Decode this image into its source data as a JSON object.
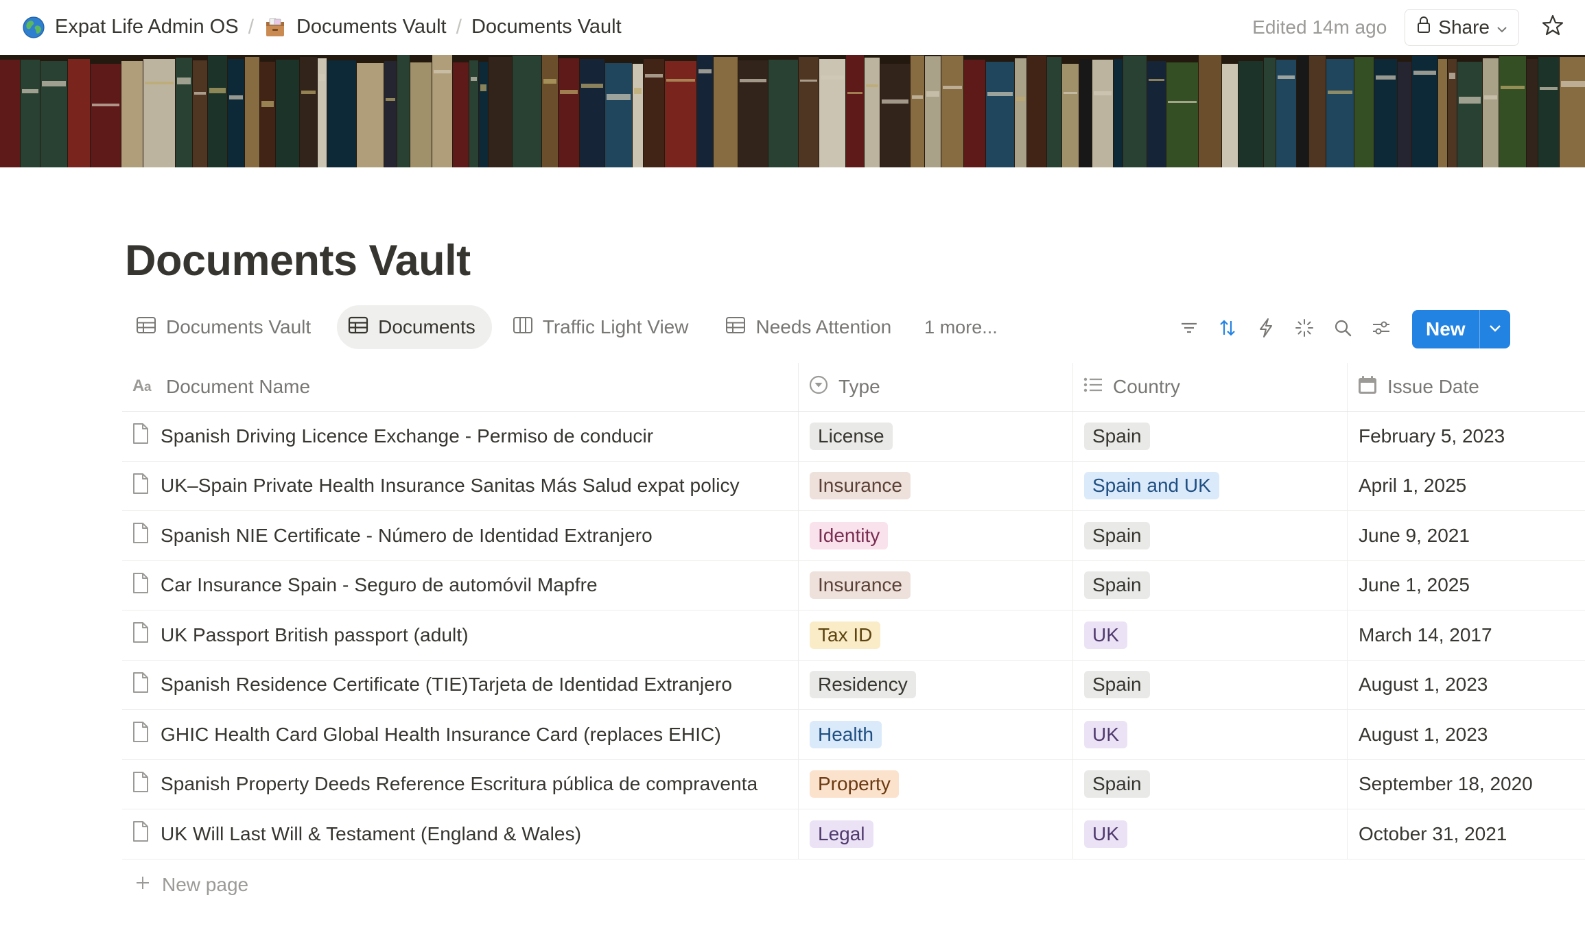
{
  "breadcrumbs": [
    {
      "label": "Expat Life Admin OS",
      "icon": "globe-icon"
    },
    {
      "label": "Documents Vault",
      "icon": "file-box-icon"
    },
    {
      "label": "Documents Vault",
      "icon": ""
    }
  ],
  "header": {
    "edited": "Edited 14m ago",
    "share_label": "Share"
  },
  "page": {
    "title": "Documents Vault"
  },
  "views": {
    "tabs": [
      {
        "label": "Documents Vault",
        "icon": "table-icon",
        "active": false
      },
      {
        "label": "Documents",
        "icon": "table-icon",
        "active": true
      },
      {
        "label": "Traffic Light View",
        "icon": "board-icon",
        "active": false
      },
      {
        "label": "Needs Attention",
        "icon": "table-icon",
        "active": false
      }
    ],
    "more": "1 more...",
    "new_label": "New"
  },
  "table": {
    "columns": [
      {
        "label": "Document Name",
        "icon": "text-type-icon"
      },
      {
        "label": "Type",
        "icon": "select-icon"
      },
      {
        "label": "Country",
        "icon": "multi-select-icon"
      },
      {
        "label": "Issue Date",
        "icon": "calendar-icon"
      }
    ],
    "rows": [
      {
        "name": "Spanish Driving Licence Exchange - Permiso de conducir",
        "type": "License",
        "country": "Spain",
        "date": "February 5, 2023"
      },
      {
        "name": "UK–Spain Private Health Insurance Sanitas Más Salud expat policy",
        "type": "Insurance",
        "country": "Spain and UK",
        "date": "April 1, 2025"
      },
      {
        "name": "Spanish NIE Certificate - Número de Identidad Extranjero",
        "type": "Identity",
        "country": "Spain",
        "date": "June 9, 2021"
      },
      {
        "name": "Car Insurance Spain - Seguro de automóvil Mapfre",
        "type": "Insurance",
        "country": "Spain",
        "date": "June 1, 2025"
      },
      {
        "name": "UK Passport British passport (adult)",
        "type": "Tax ID",
        "country": "UK",
        "date": "March 14, 2017"
      },
      {
        "name": "Spanish Residence Certificate (TIE)Tarjeta de Identidad Extranjero",
        "type": "Residency",
        "country": "Spain",
        "date": "August 1, 2023"
      },
      {
        "name": "GHIC Health Card Global Health Insurance Card (replaces EHIC)",
        "type": "Health",
        "country": "UK",
        "date": "August 1, 2023"
      },
      {
        "name": "Spanish Property Deeds Reference Escritura pública de compraventa",
        "type": "Property",
        "country": "Spain",
        "date": "September 18, 2020"
      },
      {
        "name": "UK Will Last Will & Testament (England & Wales)",
        "type": "Legal",
        "country": "UK",
        "date": "October 31, 2021"
      }
    ],
    "new_page_label": "New page"
  },
  "tag_colors": {
    "License": {
      "bg": "#e9e9e7",
      "fg": "#37352f"
    },
    "Insurance": {
      "bg": "#eee0da",
      "fg": "#5a4036"
    },
    "Identity": {
      "bg": "#f9e2ec",
      "fg": "#7a2e52"
    },
    "Tax ID": {
      "bg": "#fbecc8",
      "fg": "#5c4410"
    },
    "Residency": {
      "bg": "#e9e9e7",
      "fg": "#37352f"
    },
    "Health": {
      "bg": "#dbeafa",
      "fg": "#1f4f82"
    },
    "Property": {
      "bg": "#fbe2cc",
      "fg": "#6b3a12"
    },
    "Legal": {
      "bg": "#ebe2f5",
      "fg": "#4f3a6e"
    },
    "Spain": {
      "bg": "#e9e9e7",
      "fg": "#37352f"
    },
    "Spain and UK": {
      "bg": "#dbeafa",
      "fg": "#1f4f82"
    },
    "UK": {
      "bg": "#ebe2f5",
      "fg": "#4f3a6e"
    }
  },
  "colors": {
    "accent": "#2383e2",
    "text": "#37352f",
    "muted": "#787774"
  }
}
